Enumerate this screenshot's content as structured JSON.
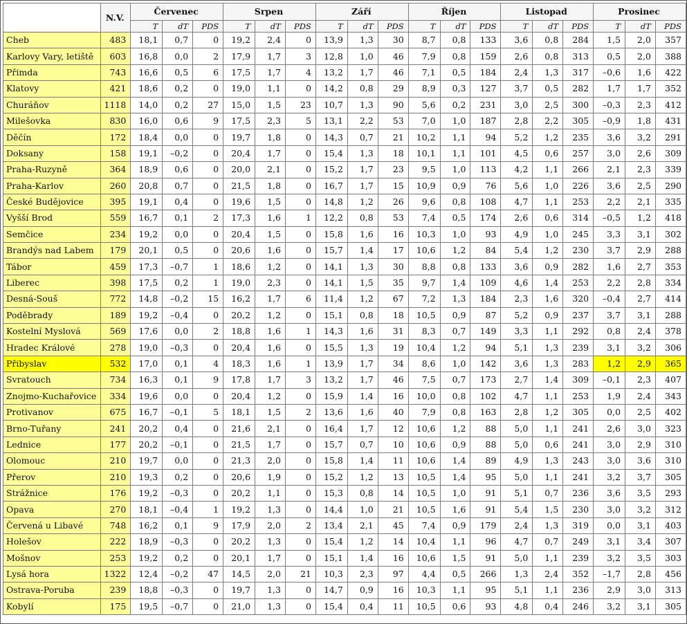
{
  "header": {
    "nv_label": "N.V.",
    "months": [
      "Červenec",
      "Srpen",
      "Září",
      "Říjen",
      "Listopad",
      "Prosinec"
    ],
    "sub_labels": [
      "T",
      "dT",
      "PDS"
    ]
  },
  "highlight": {
    "color": "#ffff00",
    "label_bg": "#ffff99"
  },
  "rows": [
    {
      "station": "Cheb",
      "nv": "483",
      "v": [
        "18,1",
        "0,7",
        "0",
        "19,2",
        "2,4",
        "0",
        "13,9",
        "1,3",
        "30",
        "8,7",
        "0,8",
        "133",
        "3,6",
        "0,8",
        "284",
        "1,5",
        "2,0",
        "357"
      ]
    },
    {
      "station": "Karlovy Vary, letiště",
      "nv": "603",
      "v": [
        "16,8",
        "0,0",
        "2",
        "17,9",
        "1,7",
        "3",
        "12,8",
        "1,0",
        "46",
        "7,9",
        "0,8",
        "159",
        "2,6",
        "0,8",
        "313",
        "0,5",
        "2,0",
        "388"
      ]
    },
    {
      "station": "Přimda",
      "nv": "743",
      "v": [
        "16,6",
        "0,5",
        "6",
        "17,5",
        "1,7",
        "4",
        "13,2",
        "1,7",
        "46",
        "7,1",
        "0,5",
        "184",
        "2,4",
        "1,3",
        "317",
        "–0,6",
        "1,6",
        "422"
      ]
    },
    {
      "station": "Klatovy",
      "nv": "421",
      "v": [
        "18,6",
        "0,2",
        "0",
        "19,0",
        "1,1",
        "0",
        "14,2",
        "0,8",
        "29",
        "8,9",
        "0,3",
        "127",
        "3,7",
        "0,5",
        "282",
        "1,7",
        "1,7",
        "352"
      ]
    },
    {
      "station": "Churáňov",
      "nv": "1118",
      "v": [
        "14,0",
        "0,2",
        "27",
        "15,0",
        "1,5",
        "23",
        "10,7",
        "1,3",
        "90",
        "5,6",
        "0,2",
        "231",
        "3,0",
        "2,5",
        "300",
        "–0,3",
        "2,3",
        "412"
      ]
    },
    {
      "station": "Milešovka",
      "nv": "830",
      "v": [
        "16,0",
        "0,6",
        "9",
        "17,5",
        "2,3",
        "5",
        "13,1",
        "2,2",
        "53",
        "7,0",
        "1,0",
        "187",
        "2,8",
        "2,2",
        "305",
        "–0,9",
        "1,8",
        "431"
      ]
    },
    {
      "station": "Děčín",
      "nv": "172",
      "v": [
        "18,4",
        "0,0",
        "0",
        "19,7",
        "1,8",
        "0",
        "14,3",
        "0,7",
        "21",
        "10,2",
        "1,1",
        "94",
        "5,2",
        "1,2",
        "235",
        "3,6",
        "3,2",
        "291"
      ]
    },
    {
      "station": "Doksany",
      "nv": "158",
      "v": [
        "19,1",
        "–0,2",
        "0",
        "20,4",
        "1,7",
        "0",
        "15,4",
        "1,3",
        "18",
        "10,1",
        "1,1",
        "101",
        "4,5",
        "0,6",
        "257",
        "3,0",
        "2,6",
        "309"
      ]
    },
    {
      "station": "Praha-Ruzyně",
      "nv": "364",
      "v": [
        "18,9",
        "0,6",
        "0",
        "20,0",
        "2,1",
        "0",
        "15,2",
        "1,7",
        "23",
        "9,5",
        "1,0",
        "113",
        "4,2",
        "1,1",
        "266",
        "2,1",
        "2,3",
        "339"
      ]
    },
    {
      "station": "Praha-Karlov",
      "nv": "260",
      "v": [
        "20,8",
        "0,7",
        "0",
        "21,5",
        "1,8",
        "0",
        "16,7",
        "1,7",
        "15",
        "10,9",
        "0,9",
        "76",
        "5,6",
        "1,0",
        "226",
        "3,6",
        "2,5",
        "290"
      ]
    },
    {
      "station": "České Budějovice",
      "nv": "395",
      "v": [
        "19,1",
        "0,4",
        "0",
        "19,6",
        "1,5",
        "0",
        "14,8",
        "1,2",
        "26",
        "9,6",
        "0,8",
        "108",
        "4,7",
        "1,1",
        "253",
        "2,2",
        "2,1",
        "335"
      ]
    },
    {
      "station": "Vyšší Brod",
      "nv": "559",
      "v": [
        "16,7",
        "0,1",
        "2",
        "17,3",
        "1,6",
        "1",
        "12,2",
        "0,8",
        "53",
        "7,4",
        "0,5",
        "174",
        "2,6",
        "0,6",
        "314",
        "–0,5",
        "1,2",
        "418"
      ]
    },
    {
      "station": "Semčice",
      "nv": "234",
      "v": [
        "19,2",
        "0,0",
        "0",
        "20,4",
        "1,5",
        "0",
        "15,8",
        "1,6",
        "16",
        "10,3",
        "1,0",
        "93",
        "4,9",
        "1,0",
        "245",
        "3,3",
        "3,1",
        "302"
      ]
    },
    {
      "station": "Brandýs nad Labem",
      "nv": "179",
      "v": [
        "20,1",
        "0,5",
        "0",
        "20,6",
        "1,6",
        "0",
        "15,7",
        "1,4",
        "17",
        "10,6",
        "1,2",
        "84",
        "5,4",
        "1,2",
        "230",
        "3,7",
        "2,9",
        "288"
      ]
    },
    {
      "station": "Tábor",
      "nv": "459",
      "v": [
        "17,3",
        "–0,7",
        "1",
        "18,6",
        "1,2",
        "0",
        "14,1",
        "1,3",
        "30",
        "8,8",
        "0,8",
        "133",
        "3,6",
        "0,9",
        "282",
        "1,6",
        "2,7",
        "353"
      ]
    },
    {
      "station": "Liberec",
      "nv": "398",
      "v": [
        "17,5",
        "0,2",
        "1",
        "19,0",
        "2,3",
        "0",
        "14,1",
        "1,5",
        "35",
        "9,7",
        "1,4",
        "109",
        "4,6",
        "1,4",
        "253",
        "2,2",
        "2,8",
        "334"
      ]
    },
    {
      "station": "Desná-Souš",
      "nv": "772",
      "v": [
        "14,8",
        "–0,2",
        "15",
        "16,2",
        "1,7",
        "6",
        "11,4",
        "1,2",
        "67",
        "7,2",
        "1,3",
        "184",
        "2,3",
        "1,6",
        "320",
        "–0,4",
        "2,7",
        "414"
      ]
    },
    {
      "station": "Poděbrady",
      "nv": "189",
      "v": [
        "19,2",
        "–0,4",
        "0",
        "20,2",
        "1,2",
        "0",
        "15,1",
        "0,8",
        "18",
        "10,5",
        "0,9",
        "87",
        "5,2",
        "0,9",
        "237",
        "3,7",
        "3,1",
        "288"
      ]
    },
    {
      "station": "Kostelní Myslová",
      "nv": "569",
      "v": [
        "17,6",
        "0,0",
        "2",
        "18,8",
        "1,6",
        "1",
        "14,3",
        "1,6",
        "31",
        "8,3",
        "0,7",
        "149",
        "3,3",
        "1,1",
        "292",
        "0,8",
        "2,4",
        "378"
      ]
    },
    {
      "station": "Hradec Králové",
      "nv": "278",
      "v": [
        "19,0",
        "–0,3",
        "0",
        "20,4",
        "1,6",
        "0",
        "15,5",
        "1,3",
        "19",
        "10,4",
        "1,2",
        "94",
        "5,1",
        "1,3",
        "239",
        "3,1",
        "3,2",
        "306"
      ]
    },
    {
      "station": "Přibyslav",
      "nv": "532",
      "hl": true,
      "v": [
        "17,0",
        "0,1",
        "4",
        "18,3",
        "1,6",
        "1",
        "13,9",
        "1,7",
        "34",
        "8,6",
        "1,0",
        "142",
        "3,6",
        "1,3",
        "283",
        "1,2",
        "2,9",
        "365"
      ]
    },
    {
      "station": "Svratouch",
      "nv": "734",
      "v": [
        "16,3",
        "0,1",
        "9",
        "17,8",
        "1,7",
        "3",
        "13,2",
        "1,7",
        "46",
        "7,5",
        "0,7",
        "173",
        "2,7",
        "1,4",
        "309",
        "–0,1",
        "2,3",
        "407"
      ]
    },
    {
      "station": "Znojmo-Kuchařovice",
      "nv": "334",
      "v": [
        "19,6",
        "0,0",
        "0",
        "20,4",
        "1,2",
        "0",
        "15,9",
        "1,4",
        "16",
        "10,0",
        "0,8",
        "102",
        "4,7",
        "1,1",
        "253",
        "1,9",
        "2,4",
        "343"
      ]
    },
    {
      "station": "Protivanov",
      "nv": "675",
      "v": [
        "16,7",
        "–0,1",
        "5",
        "18,1",
        "1,5",
        "2",
        "13,6",
        "1,6",
        "40",
        "7,9",
        "0,8",
        "163",
        "2,8",
        "1,2",
        "305",
        "0,0",
        "2,5",
        "402"
      ]
    },
    {
      "station": "Brno-Tuřany",
      "nv": "241",
      "v": [
        "20,2",
        "0,4",
        "0",
        "21,6",
        "2,1",
        "0",
        "16,4",
        "1,7",
        "12",
        "10,6",
        "1,2",
        "88",
        "5,0",
        "1,1",
        "241",
        "2,6",
        "3,0",
        "323"
      ]
    },
    {
      "station": "Lednice",
      "nv": "177",
      "v": [
        "20,2",
        "–0,1",
        "0",
        "21,5",
        "1,7",
        "0",
        "15,7",
        "0,7",
        "10",
        "10,6",
        "0,9",
        "88",
        "5,0",
        "0,6",
        "241",
        "3,0",
        "2,9",
        "310"
      ]
    },
    {
      "station": "Olomouc",
      "nv": "210",
      "v": [
        "19,7",
        "0,0",
        "0",
        "21,3",
        "2,0",
        "0",
        "15,8",
        "1,4",
        "11",
        "10,6",
        "1,4",
        "89",
        "4,9",
        "1,3",
        "243",
        "3,0",
        "3,6",
        "310"
      ]
    },
    {
      "station": "Přerov",
      "nv": "210",
      "v": [
        "19,3",
        "0,2",
        "0",
        "20,6",
        "1,9",
        "0",
        "15,2",
        "1,2",
        "13",
        "10,5",
        "1,4",
        "95",
        "5,0",
        "1,1",
        "241",
        "3,2",
        "3,7",
        "305"
      ]
    },
    {
      "station": "Strážnice",
      "nv": "176",
      "v": [
        "19,2",
        "–0,3",
        "0",
        "20,2",
        "1,1",
        "0",
        "15,3",
        "0,8",
        "14",
        "10,5",
        "1,0",
        "91",
        "5,1",
        "0,7",
        "236",
        "3,6",
        "3,5",
        "293"
      ]
    },
    {
      "station": "Opava",
      "nv": "270",
      "v": [
        "18,1",
        "–0,4",
        "1",
        "19,2",
        "1,3",
        "0",
        "14,4",
        "1,0",
        "21",
        "10,5",
        "1,6",
        "91",
        "5,4",
        "1,5",
        "230",
        "3,0",
        "3,2",
        "312"
      ]
    },
    {
      "station": "Červená u Libavé",
      "nv": "748",
      "v": [
        "16,2",
        "0,1",
        "9",
        "17,9",
        "2,0",
        "2",
        "13,4",
        "2,1",
        "45",
        "7,4",
        "0,9",
        "179",
        "2,4",
        "1,3",
        "319",
        "0,0",
        "3,1",
        "403"
      ]
    },
    {
      "station": "Holešov",
      "nv": "222",
      "v": [
        "18,9",
        "–0,3",
        "0",
        "20,2",
        "1,3",
        "0",
        "15,4",
        "1,2",
        "14",
        "10,4",
        "1,1",
        "96",
        "4,7",
        "0,7",
        "249",
        "3,1",
        "3,4",
        "307"
      ]
    },
    {
      "station": "Mošnov",
      "nv": "253",
      "v": [
        "19,2",
        "0,2",
        "0",
        "20,1",
        "1,7",
        "0",
        "15,1",
        "1,4",
        "16",
        "10,6",
        "1,5",
        "91",
        "5,0",
        "1,1",
        "239",
        "3,2",
        "3,5",
        "303"
      ]
    },
    {
      "station": "Lysá hora",
      "nv": "1322",
      "v": [
        "12,4",
        "–0,2",
        "47",
        "14,5",
        "2,0",
        "21",
        "10,3",
        "2,3",
        "97",
        "4,4",
        "0,5",
        "266",
        "1,3",
        "2,4",
        "352",
        "–1,7",
        "2,8",
        "456"
      ]
    },
    {
      "station": "Ostrava-Poruba",
      "nv": "239",
      "v": [
        "18,8",
        "–0,3",
        "0",
        "19,7",
        "1,3",
        "0",
        "14,7",
        "0,9",
        "16",
        "10,3",
        "1,1",
        "95",
        "5,1",
        "1,1",
        "236",
        "2,9",
        "3,0",
        "313"
      ]
    },
    {
      "station": "Kobylí",
      "nv": "175",
      "v": [
        "19,5",
        "–0,7",
        "0",
        "21,0",
        "1,3",
        "0",
        "15,4",
        "0,4",
        "11",
        "10,5",
        "0,6",
        "93",
        "4,8",
        "0,4",
        "246",
        "3,2",
        "3,1",
        "305"
      ]
    }
  ]
}
